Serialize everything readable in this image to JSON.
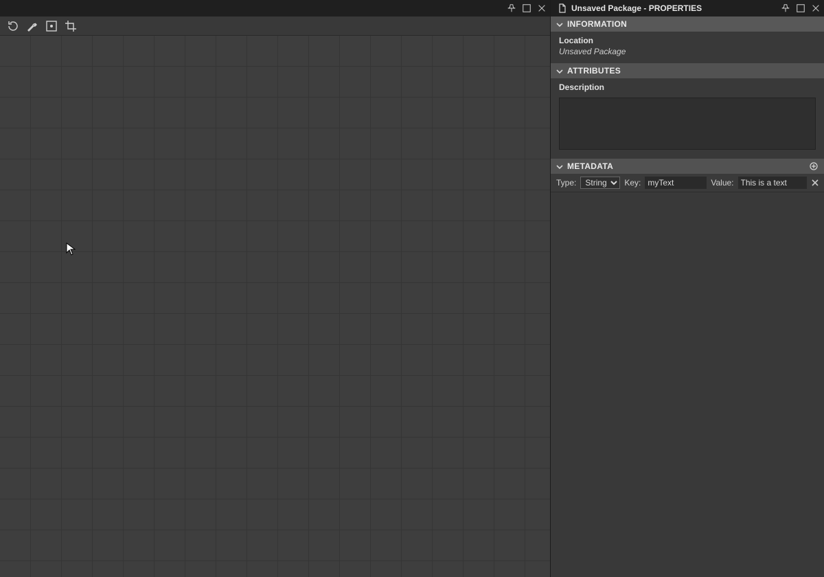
{
  "propertiesPanel": {
    "title": "Unsaved Package - PROPERTIES",
    "sections": {
      "information": {
        "header": "INFORMATION",
        "locationLabel": "Location",
        "locationValue": "Unsaved Package"
      },
      "attributes": {
        "header": "ATTRIBUTES",
        "descriptionLabel": "Description",
        "descriptionValue": ""
      },
      "metadata": {
        "header": "METADATA",
        "row": {
          "typeLabel": "Type:",
          "typeValue": "String",
          "typeOptions": [
            "String"
          ],
          "keyLabel": "Key:",
          "keyValue": "myText",
          "valueLabel": "Value:",
          "valueValue": "This is a text"
        }
      }
    }
  }
}
